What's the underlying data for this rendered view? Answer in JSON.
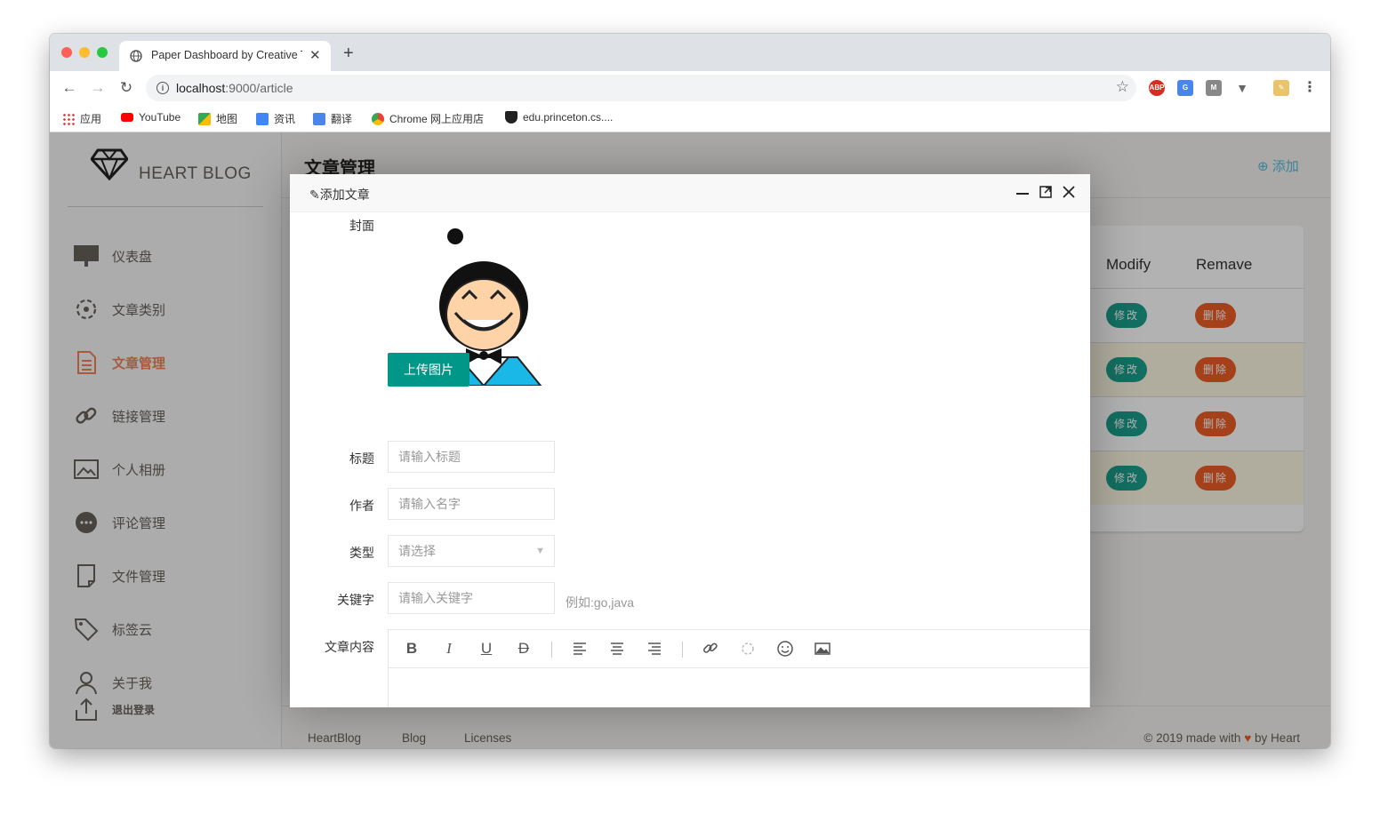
{
  "browser": {
    "tab_title": "Paper Dashboard by Creative T",
    "url_host": "localhost",
    "url_rest": ":9000/article",
    "bookmarks": [
      "应用",
      "YouTube",
      "地图",
      "资讯",
      "翻译",
      "Chrome 网上应用店",
      "edu.princeton.cs...."
    ]
  },
  "sidebar": {
    "brand": "HEART BLOG",
    "items": [
      {
        "label": "仪表盘",
        "icon": "monitor-icon"
      },
      {
        "label": "文章类别",
        "icon": "settings-gear-icon"
      },
      {
        "label": "文章管理",
        "icon": "document-icon",
        "active": true
      },
      {
        "label": "链接管理",
        "icon": "link-icon"
      },
      {
        "label": "个人相册",
        "icon": "image-album-icon"
      },
      {
        "label": "评论管理",
        "icon": "chat-bubble-icon"
      },
      {
        "label": "文件管理",
        "icon": "file-icon"
      },
      {
        "label": "标签云",
        "icon": "tag-icon"
      },
      {
        "label": "关于我",
        "icon": "user-icon"
      },
      {
        "label": "退出登录",
        "icon": "upload-logout-icon"
      }
    ]
  },
  "main": {
    "title": "文章管理",
    "add_label": "添加",
    "columns": [
      "Modify",
      "Remave"
    ],
    "modify_label": "修改",
    "delete_label": "删除"
  },
  "footer": {
    "links": [
      "HeartBlog",
      "Blog",
      "Licenses"
    ],
    "copyright_pre": "© 2019 made with",
    "copyright_post": "by Heart"
  },
  "modal": {
    "title": "添加文章",
    "cover_label": "封面",
    "upload_label": "上传图片",
    "title_label": "标题",
    "title_placeholder": "请输入标题",
    "author_label": "作者",
    "author_placeholder": "请输入名字",
    "type_label": "类型",
    "type_placeholder": "请选择",
    "keywords_label": "关键字",
    "keywords_placeholder": "请输入关键字",
    "keywords_hint": "例如:go,java",
    "content_label": "文章内容"
  },
  "colors": {
    "accent_orange": "#eb5e28",
    "teal": "#1a9f8c",
    "upload_green": "#009688",
    "info_blue": "#51bcda"
  }
}
